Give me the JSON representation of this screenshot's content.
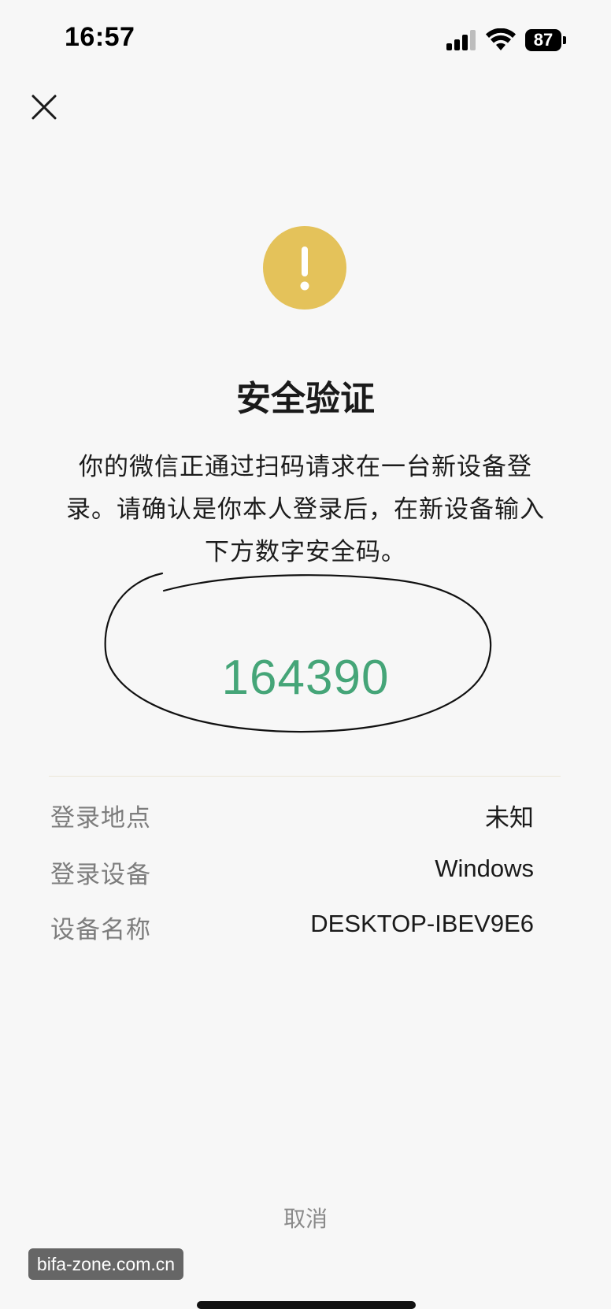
{
  "status_bar": {
    "time": "16:57",
    "battery_level": "87",
    "icons": [
      "signal-icon",
      "wifi-icon",
      "battery-icon"
    ]
  },
  "header": {
    "close_icon": "close-icon"
  },
  "warning": {
    "icon": "exclamation-icon",
    "color": "#e4c25a"
  },
  "title": "安全验证",
  "description": "你的微信正通过扫码请求在一台新设备登录。请确认是你本人登录后，在新设备输入下方数字安全码。",
  "security_code": "164390",
  "code_color": "#45a578",
  "details": [
    {
      "label": "登录地点",
      "value": "未知"
    },
    {
      "label": "登录设备",
      "value": "Windows"
    },
    {
      "label": "设备名称",
      "value": "DESKTOP-IBEV9E6"
    }
  ],
  "cancel_label": "取消",
  "watermark": "bifa-zone.com.cn"
}
